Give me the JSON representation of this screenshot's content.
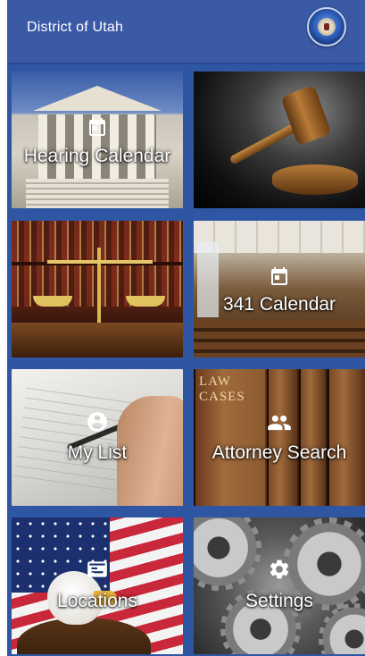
{
  "header": {
    "title": "District of Utah"
  },
  "tiles": [
    {
      "label": "Hearing Calendar",
      "icon": "calendar-icon",
      "background": "courthouse-photo"
    },
    {
      "label": "",
      "icon": "",
      "background": "gavel-photo"
    },
    {
      "label": "",
      "icon": "",
      "background": "scales-of-justice-photo"
    },
    {
      "label": "341 Calendar",
      "icon": "calendar-icon",
      "background": "courtroom-photo"
    },
    {
      "label": "My List",
      "icon": "person-icon",
      "background": "writing-hand-photo"
    },
    {
      "label": "Attorney Search",
      "icon": "people-icon",
      "background": "law-books-photo"
    },
    {
      "label": "Locations",
      "icon": "id-card-icon",
      "background": "eagle-flag-photo"
    },
    {
      "label": "Settings",
      "icon": "gear-icon",
      "background": "gears-photo"
    }
  ],
  "law_books_text": [
    "LAW",
    "CASES"
  ],
  "colors": {
    "header_bg": "#3b5aa6",
    "app_bg": "#2f56a3",
    "label_text": "#ffffff"
  }
}
